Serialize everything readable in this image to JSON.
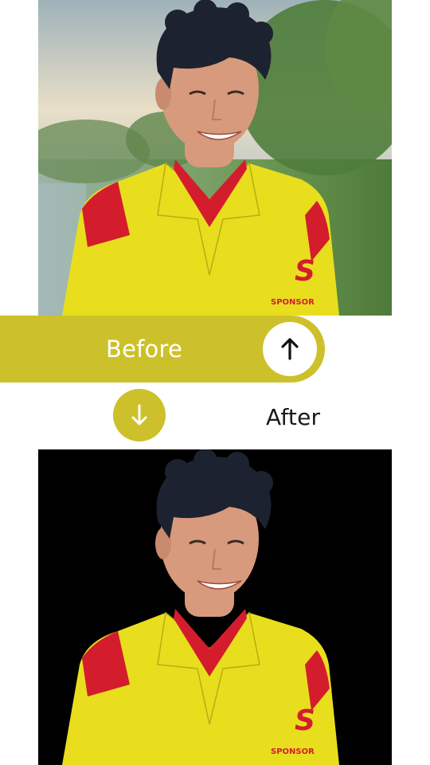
{
  "colors": {
    "accent": "#cdc12b",
    "shirt": "#e8de1e",
    "shirt_accent": "#d41d2c",
    "hair": "#1d2230",
    "skin": "#d89a7c",
    "after_background": "#000000"
  },
  "labels": {
    "before": "Before",
    "after": "After"
  },
  "icons": {
    "up": "arrow-up-icon",
    "down": "arrow-down-icon"
  },
  "photo": {
    "logo_text": "SPONSOR"
  }
}
